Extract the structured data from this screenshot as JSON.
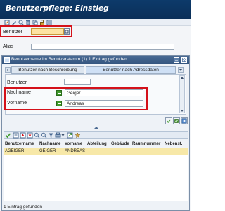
{
  "header": {
    "title": "Benutzerpflege: Einstieg"
  },
  "toolbar": {
    "icons": [
      "create-icon",
      "change-icon",
      "display-icon",
      "delete-icon",
      "copy-icon",
      "lock-icon",
      "info-icon"
    ]
  },
  "entry": {
    "benutzer_label": "Benutzer",
    "benutzer_value": "",
    "alias_label": "Alias",
    "alias_value": ""
  },
  "dialog": {
    "title": "Benutzername im Benutzerstamm (1)  1 Eintrag gefunden",
    "tabs": [
      "Benutzer nach Beschreibung",
      "Benutzer nach Adressdaten"
    ],
    "active_tab": "Benutzer nach Adressdaten",
    "fields": {
      "benutzer_label": "Benutzer",
      "benutzer_value": "",
      "nachname_label": "Nachname",
      "nachname_value": "Geiger",
      "vorname_label": "Vorname",
      "vorname_value": "Andreas"
    },
    "table": {
      "columns": [
        "Benutzername",
        "Nachname",
        "Vorname",
        "Abteilung",
        "Gebäude",
        "Raumnummer",
        "Nebenst."
      ],
      "rows": [
        [
          "AGEIGER",
          "GEIGER",
          "ANDREAS",
          "",
          "",
          "",
          ""
        ]
      ]
    },
    "status": "1 Eintrag gefunden"
  },
  "colors": {
    "header_bg": "#0b2f58",
    "highlight_red": "#d4111a",
    "input_yellow": "#fde3a3",
    "selected_row": "#f7e8a8",
    "green_button": "#3f9a2a"
  }
}
